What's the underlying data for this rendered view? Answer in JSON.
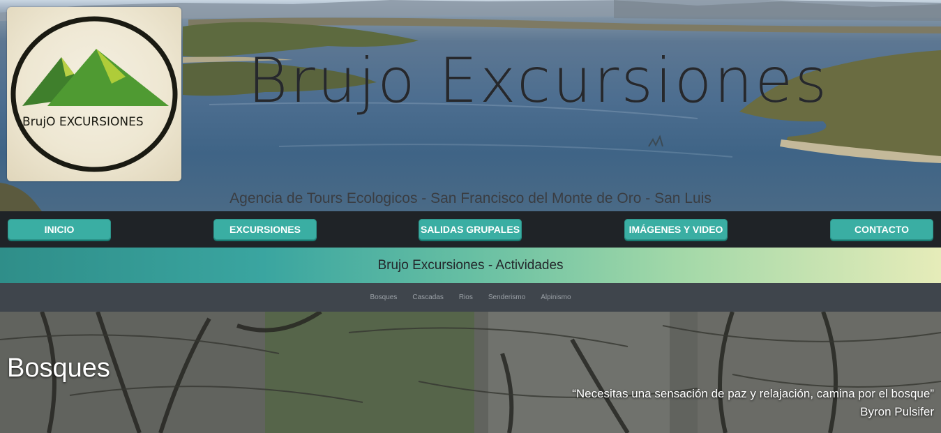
{
  "header": {
    "logo_text": "BrujO EXCURSIONES",
    "title": "Brujo Excursiones",
    "subtitle": "Agencia de Tours Ecologicos - San Francisco del Monte de Oro - San Luis"
  },
  "nav": {
    "items": [
      {
        "label": "INICIO"
      },
      {
        "label": "EXCURSIONES"
      },
      {
        "label": "SALIDAS GRUPALES"
      },
      {
        "label": "IMÁGENES Y VIDEO"
      },
      {
        "label": "CONTACTO"
      }
    ]
  },
  "banner": {
    "title": "Brujo Excursiones - Actividades"
  },
  "subnav": {
    "items": [
      {
        "label": "Bosques"
      },
      {
        "label": "Cascadas"
      },
      {
        "label": "Rios"
      },
      {
        "label": "Senderismo"
      },
      {
        "label": "Alpinismo"
      }
    ]
  },
  "section": {
    "title": "Bosques",
    "quote": "“Necesitas una sensación de paz y relajación, camina por el bosque”",
    "author": "Byron Pulsifer"
  },
  "colors": {
    "nav_bg": "#1f2327",
    "button": "#3aaea3",
    "subnav_bg": "#3f454c",
    "banner_start": "#2f8e89",
    "banner_end": "#e6ecb9"
  }
}
